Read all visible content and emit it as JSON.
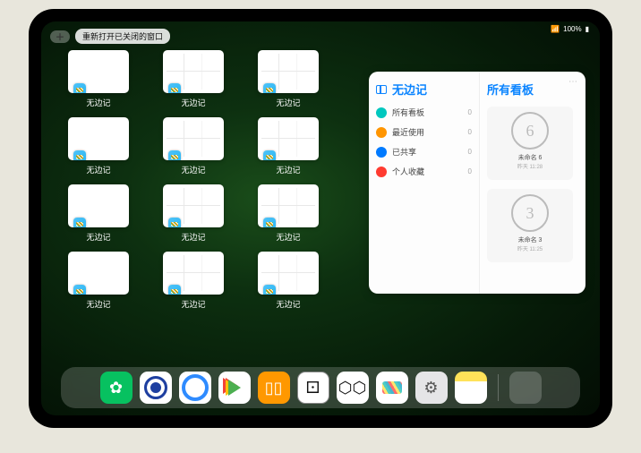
{
  "status": {
    "battery": "100%"
  },
  "top_controls": {
    "plus_symbol": "＋",
    "restore_tab_label": "重新打开已关闭的窗口"
  },
  "app_switcher": {
    "label": "无边记",
    "windows": [
      {
        "variant": "blank"
      },
      {
        "variant": "grid"
      },
      {
        "variant": "grid"
      },
      {
        "variant": "blank"
      },
      {
        "variant": "grid"
      },
      {
        "variant": "grid"
      },
      {
        "variant": "blank"
      },
      {
        "variant": "grid"
      },
      {
        "variant": "grid"
      },
      {
        "variant": "blank"
      },
      {
        "variant": "grid"
      },
      {
        "variant": "grid"
      }
    ]
  },
  "panel": {
    "left": {
      "title": "无边记",
      "items": [
        {
          "icon_name": "all-boards",
          "color": "#00c7be",
          "label": "所有看板",
          "count": "0"
        },
        {
          "icon_name": "recent",
          "color": "#ff9500",
          "label": "最近使用",
          "count": "0"
        },
        {
          "icon_name": "shared",
          "color": "#007aff",
          "label": "已共享",
          "count": "0"
        },
        {
          "icon_name": "favorites",
          "color": "#ff3b30",
          "label": "个人收藏",
          "count": "0"
        }
      ]
    },
    "right": {
      "title": "所有看板",
      "boards": [
        {
          "preview_digit": "6",
          "title": "未命名 6",
          "meta": "昨天 11:28"
        },
        {
          "preview_digit": "3",
          "title": "未命名 3",
          "meta": "昨天 11:25"
        }
      ]
    }
  },
  "dock": {
    "apps": [
      {
        "name": "wechat"
      },
      {
        "name": "dot-blue"
      },
      {
        "name": "q-blue"
      },
      {
        "name": "play"
      },
      {
        "name": "books"
      },
      {
        "name": "dice"
      },
      {
        "name": "hex"
      },
      {
        "name": "freeform-dock"
      },
      {
        "name": "settings"
      },
      {
        "name": "notes"
      }
    ]
  }
}
